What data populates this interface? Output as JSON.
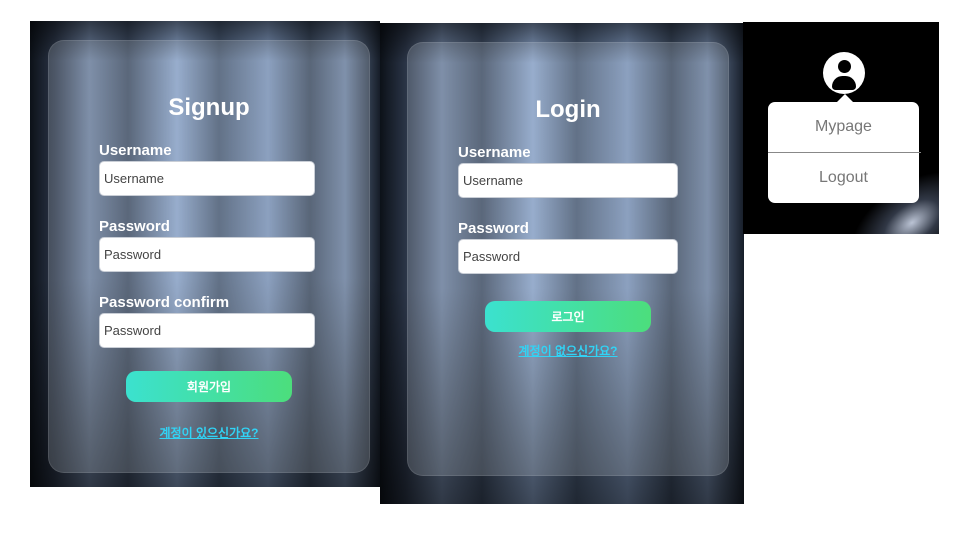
{
  "signup": {
    "title": "Signup",
    "username_label": "Username",
    "username_placeholder": "Username",
    "password_label": "Password",
    "password_placeholder": "Password",
    "confirm_label": "Password confirm",
    "confirm_placeholder": "Password",
    "submit_label": "회원가입",
    "switch_link": "계정이 있으신가요?"
  },
  "login": {
    "title": "Login",
    "username_label": "Username",
    "username_placeholder": "Username",
    "password_label": "Password",
    "password_placeholder": "Password",
    "submit_label": "로그인",
    "switch_link": "계정이 없으신가요?"
  },
  "profile_menu": {
    "avatar_icon": "user-circle-icon",
    "items": [
      "Mypage",
      "Logout"
    ]
  },
  "colors": {
    "button_gradient_start": "#3be1cf",
    "button_gradient_end": "#4cde7c",
    "link": "#31d3f5"
  }
}
